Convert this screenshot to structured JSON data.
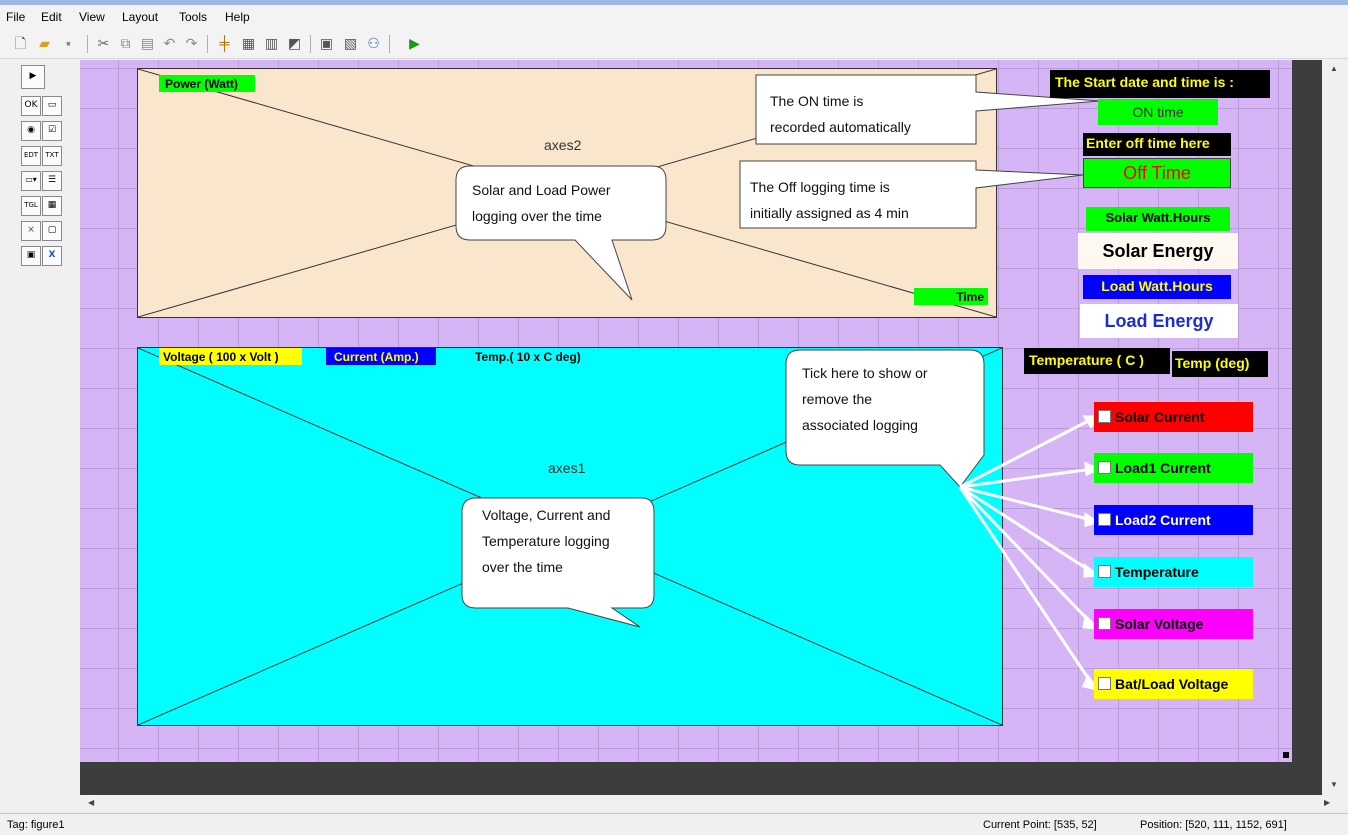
{
  "menu": [
    "File",
    "Edit",
    "View",
    "Layout",
    "Tools",
    "Help"
  ],
  "toolbar_icons": [
    "new-file-icon",
    "open-folder-icon",
    "save-icon",
    "cut-icon",
    "copy-icon",
    "paste-icon",
    "undo-icon",
    "redo-icon",
    "align-icon",
    "menu-editor-icon",
    "tab-order-icon",
    "toolbar-editor-icon",
    "mfile-editor-icon",
    "property-inspector-icon",
    "object-browser-icon",
    "run-icon"
  ],
  "palette_icons": [
    "select-arrow-icon",
    "push-button-icon",
    "slider-icon",
    "radio-button-icon",
    "checkbox-icon",
    "edit-text-icon",
    "static-text-icon",
    "popup-menu-icon",
    "listbox-icon",
    "toggle-button-icon",
    "table-icon",
    "axes-icon",
    "panel-icon",
    "button-group-icon",
    "activex-icon"
  ],
  "palette_glyphs": [
    "▶",
    "OK",
    "▭",
    "◉",
    "☑",
    "EDT",
    "TXT",
    "▭▾",
    "☰",
    "TGL",
    "▦",
    "⨯",
    "▢",
    "▣",
    "X"
  ],
  "axes2": {
    "name": "axes2",
    "ylabel": "Power (Watt)",
    "xlabel": "Time"
  },
  "axes1": {
    "name": "axes1",
    "label_voltage": "Voltage ( 100 x Volt )",
    "label_current": "Current (Amp.)",
    "label_temp": "Temp.( 10 x C deg)"
  },
  "callouts": {
    "power": [
      "Solar and Load Power",
      "logging over the time"
    ],
    "on_time": [
      "The ON time is",
      "recorded automatically"
    ],
    "off_time": [
      "The Off logging time is",
      "initially assigned  as 4 min"
    ],
    "voltage": [
      "Voltage, Current and",
      "Temperature   logging",
      "over the time"
    ],
    "tick": [
      "Tick here to show or",
      "remove the",
      "associated  logging"
    ]
  },
  "right_panel": {
    "start_label": "The Start date and time is :",
    "on_time": "ON time",
    "off_label": "Enter off time here",
    "off_time": "Off Time",
    "solar_wh_label": "Solar Watt.Hours",
    "solar_energy": "Solar Energy",
    "load_wh_label": "Load Watt.Hours",
    "load_energy": "Load Energy",
    "temp_label": "Temperature ( C  )",
    "temp_value": "Temp (deg)"
  },
  "checkboxes": [
    {
      "label": "Solar Current",
      "color": "#ff0000",
      "text_color": "#000000",
      "checked": false
    },
    {
      "label": "Load1 Current",
      "color": "#00ff00",
      "text_color": "#000000",
      "checked": false
    },
    {
      "label": "Load2 Current",
      "color": "#0000ff",
      "text_color": "#ffffff",
      "checked": false
    },
    {
      "label": "Temperature",
      "color": "#00ffff",
      "text_color": "#000000",
      "checked": false
    },
    {
      "label": "Solar Voltage",
      "color": "#ff00ff",
      "text_color": "#000000",
      "checked": false
    },
    {
      "label": "Bat/Load Voltage",
      "color": "#ffff00",
      "text_color": "#000000",
      "checked": false
    }
  ],
  "status": {
    "tag": "Tag: figure1",
    "current_point": "Current Point:  [535, 52]",
    "position": "Position: [520, 111, 1152, 691]"
  },
  "colors": {
    "canvas": "#d6b5f7",
    "axes2_bg": "#fae5cd",
    "axes1_bg": "#00ffff",
    "green": "#00ff00",
    "black": "#000000",
    "blue": "#0000ff"
  }
}
